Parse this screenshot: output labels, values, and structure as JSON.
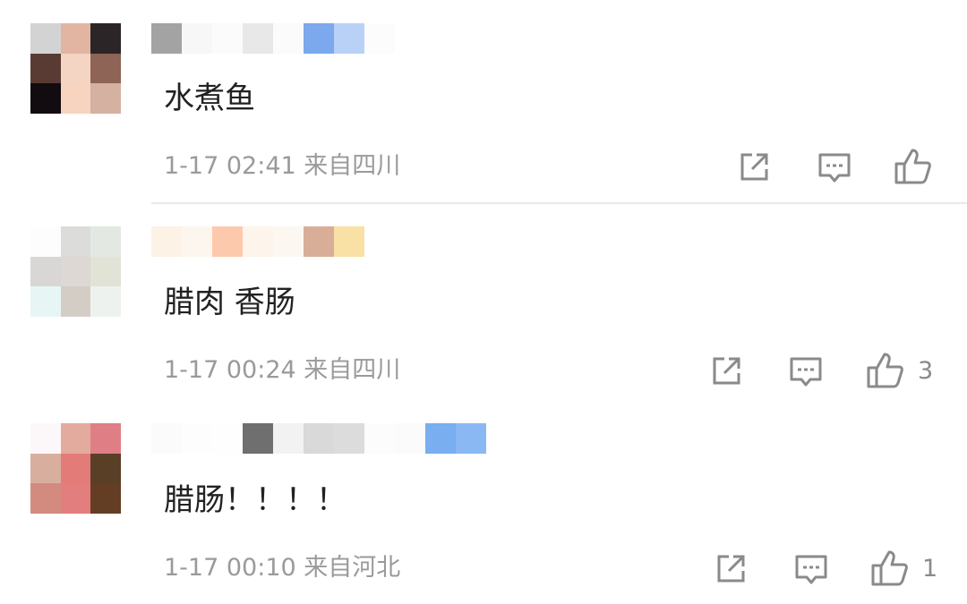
{
  "comments": [
    {
      "avatar_colors": [
        "#d4d3d4",
        "#e1b5a2",
        "#2b2527",
        "#5a3b34",
        "#f4d4c2",
        "#8e6456",
        "#120c10",
        "#f6d4c0",
        "#d5b1a1"
      ],
      "username_colors": [
        "#a3a3a3",
        "#f7f7f7",
        "#fbfbfb",
        "#e8e8e8",
        "#fbfbfb",
        "#7ca8ee",
        "#b9d1f7",
        "#fcfcfc"
      ],
      "text": "水煮鱼",
      "time": "1-17 02:41",
      "location": "来自四川",
      "likes": ""
    },
    {
      "avatar_colors": [
        "#fdfdfd",
        "#dcdcdb",
        "#e4e8e3",
        "#d8d7d5",
        "#ddd8d3",
        "#e1e3d7",
        "#e7f6f4",
        "#d4cdc6",
        "#eef2ee"
      ],
      "username_colors": [
        "#fdf2e6",
        "#fdf6ee",
        "#fdc9ac",
        "#fdf4ec",
        "#fdf7f1",
        "#d9ae99",
        "#f9e1a5"
      ],
      "text": "腊肉 香肠",
      "time": "1-17 00:24",
      "location": "来自四川",
      "likes": "3"
    },
    {
      "avatar_colors": [
        "#fcf8f9",
        "#e3aa9e",
        "#e07e86",
        "#d8ae9e",
        "#e37b79",
        "#5a3f27",
        "#d38a7f",
        "#e27e7d",
        "#633e24"
      ],
      "username_colors": [
        "#fbfbfb",
        "#fdfdfd",
        "#fefefe",
        "#6f6f6f",
        "#f2f2f2",
        "#d9d9d9",
        "#dcdcdc",
        "#fcfcfc",
        "#fafbfa",
        "#79aef0",
        "#8ab8f3"
      ],
      "text": "腊肠！！！！",
      "time": "1-17 00:10",
      "location": "来自河北",
      "likes": "1"
    }
  ],
  "icons": {
    "share": "share-icon",
    "comment": "comment-icon",
    "like": "thumbs-up-icon"
  }
}
